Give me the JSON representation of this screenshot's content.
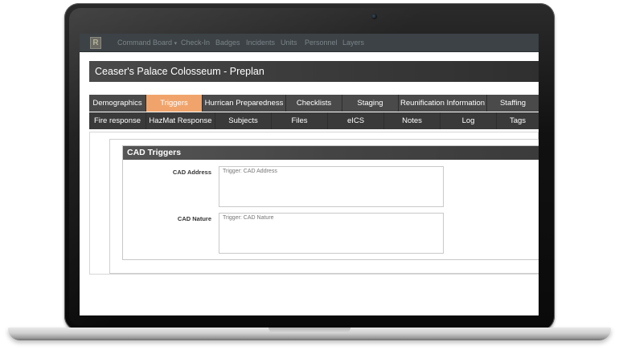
{
  "topnav": {
    "items": [
      {
        "label": "Command Board",
        "caret": "▾"
      },
      {
        "label": "Check-In"
      },
      {
        "label": "Badges"
      },
      {
        "label": "Incidents"
      },
      {
        "label": "Units"
      },
      {
        "label": "Personnel"
      },
      {
        "label": "Layers"
      }
    ]
  },
  "page": {
    "title": "Ceaser's Palace Colosseum - Preplan"
  },
  "tabs": {
    "row1": [
      "Demographics",
      "Triggers",
      "Hurrican Preparedness",
      "Checklists",
      "Staging",
      "Reunification Information",
      "Staffing"
    ],
    "row2": [
      "Fire response",
      "HazMat Response",
      "Subjects",
      "Files",
      "eICS",
      "Notes",
      "Log",
      "Tags"
    ],
    "active": "Triggers"
  },
  "section": {
    "title": "CAD Triggers",
    "fields": [
      {
        "label": "CAD Address",
        "placeholder": "Trigger: CAD Address",
        "value": ""
      },
      {
        "label": "CAD Nature",
        "placeholder": "Trigger: CAD Nature",
        "value": ""
      }
    ]
  },
  "colors": {
    "active_tab": "#f0a46b",
    "tab": "#4a4a4a",
    "nav": "#3c4246"
  }
}
